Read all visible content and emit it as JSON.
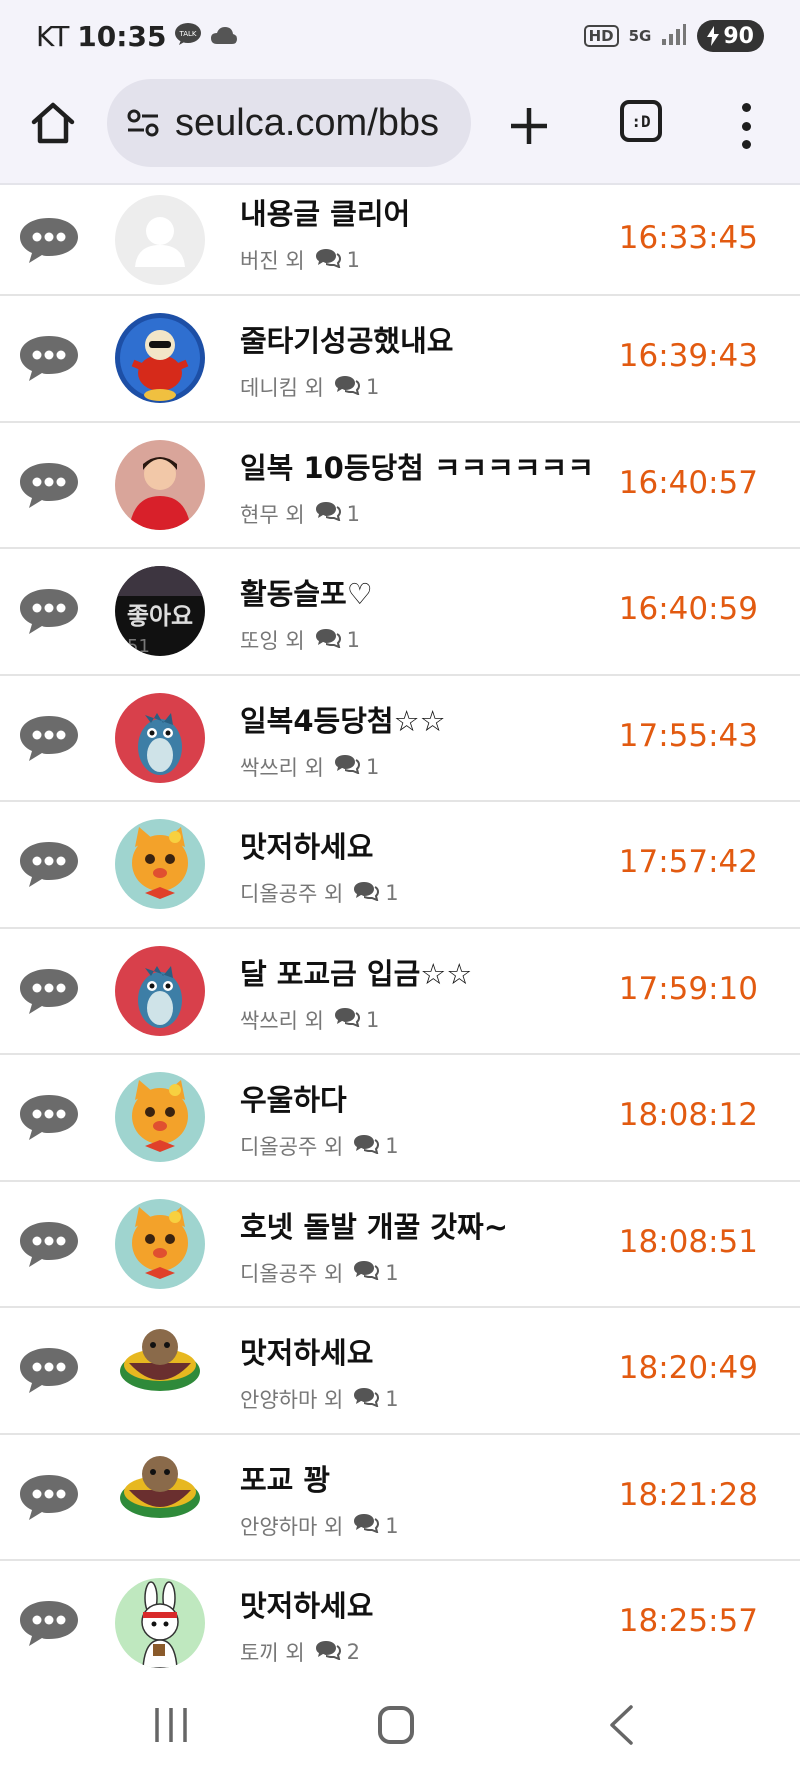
{
  "status_bar": {
    "carrier": "KT",
    "time": "10:35",
    "talk_badge": "TALK",
    "hd_badge": "HD",
    "network": "5G",
    "battery": "90"
  },
  "browser": {
    "url": "seulca.com/bbs",
    "tab_switcher_label": ":D"
  },
  "posts": [
    {
      "title": "내용글 클리어",
      "author": "버진 외",
      "comments": "1",
      "time": "16:33:45",
      "avatar": "default"
    },
    {
      "title": "줄타기성공했내요",
      "author": "데니킴 외",
      "comments": "1",
      "time": "16:39:43",
      "avatar": "bird"
    },
    {
      "title": "일복 10등당첨 ㅋㅋㅋㅋㅋㅋ",
      "author": "현무 외",
      "comments": "1",
      "time": "16:40:57",
      "avatar": "person"
    },
    {
      "title": "활동슬포♡",
      "author": "또잉 외",
      "comments": "1",
      "time": "16:40:59",
      "avatar": "dark"
    },
    {
      "title": "일복4등당첨☆☆",
      "author": "싹쓰리 외",
      "comments": "1",
      "time": "17:55:43",
      "avatar": "dino"
    },
    {
      "title": "맛저하세요",
      "author": "디올공주 외",
      "comments": "1",
      "time": "17:57:42",
      "avatar": "cat"
    },
    {
      "title": "달 포교금 입금☆☆",
      "author": "싹쓰리 외",
      "comments": "1",
      "time": "17:59:10",
      "avatar": "dino"
    },
    {
      "title": "우울하다",
      "author": "디올공주 외",
      "comments": "1",
      "time": "18:08:12",
      "avatar": "cat"
    },
    {
      "title": "호넷 돌발 개꿀 갓짜~",
      "author": "디올공주 외",
      "comments": "1",
      "time": "18:08:51",
      "avatar": "cat"
    },
    {
      "title": "맛저하세요",
      "author": "안양하마 외",
      "comments": "1",
      "time": "18:20:49",
      "avatar": "bowl"
    },
    {
      "title": "포교 꽝",
      "author": "안양하마 외",
      "comments": "1",
      "time": "18:21:28",
      "avatar": "bowl"
    },
    {
      "title": "맛저하세요",
      "author": "토끼 외",
      "comments": "2",
      "time": "18:25:57",
      "avatar": "rabbit"
    }
  ],
  "colors": {
    "time": "#e25a10",
    "chrome_bg": "#f4f3fa",
    "url_bg": "#e3e2ec",
    "bubble_icon": "#6b6b6b"
  },
  "icons": {
    "home": "home-icon",
    "site_info": "tune-icon",
    "new_tab": "plus-icon",
    "menu": "more-vert-icon",
    "row": "speech-bubble-icon",
    "comment": "comment-icon"
  }
}
